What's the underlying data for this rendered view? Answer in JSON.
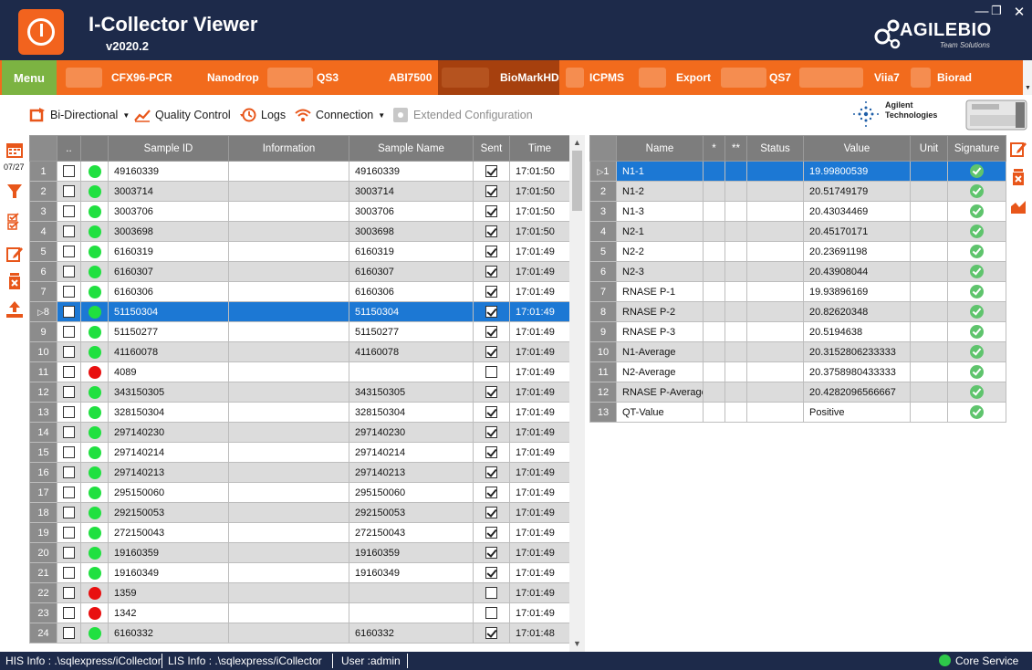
{
  "app": {
    "title": "I-Collector Viewer",
    "version": "v2020.2",
    "brand_name": "AGILEBIO",
    "brand_tagline": "Team Solutions"
  },
  "nav": {
    "menu_label": "Menu",
    "items": [
      "CFX96-PCR",
      "Nanodrop",
      "QS3",
      "ABI7500",
      "BioMarkHD",
      "ICPMS",
      "Export",
      "QS7",
      "Viia7",
      "Biorad"
    ],
    "active": "BioMarkHD"
  },
  "toolbar": {
    "bidirectional": "Bi-Directional",
    "quality_control": "Quality Control",
    "logs": "Logs",
    "connection": "Connection",
    "extended_configuration": "Extended Configuration"
  },
  "agilent": {
    "line1": "Agilent",
    "line2": "Technologies"
  },
  "side": {
    "date_label": "07/27"
  },
  "samples": {
    "columns": [
      "..",
      "Sample ID",
      "Information",
      "Sample Name",
      "Sent",
      "Time"
    ],
    "rows": [
      {
        "n": "1",
        "status": "green",
        "id": "49160339",
        "info": "",
        "name": "49160339",
        "sent": true,
        "time": "17:01:50"
      },
      {
        "n": "2",
        "status": "green",
        "id": "3003714",
        "info": "",
        "name": "3003714",
        "sent": true,
        "time": "17:01:50"
      },
      {
        "n": "3",
        "status": "green",
        "id": "3003706",
        "info": "",
        "name": "3003706",
        "sent": true,
        "time": "17:01:50"
      },
      {
        "n": "4",
        "status": "green",
        "id": "3003698",
        "info": "",
        "name": "3003698",
        "sent": true,
        "time": "17:01:50"
      },
      {
        "n": "5",
        "status": "green",
        "id": "6160319",
        "info": "",
        "name": "6160319",
        "sent": true,
        "time": "17:01:49"
      },
      {
        "n": "6",
        "status": "green",
        "id": "6160307",
        "info": "",
        "name": "6160307",
        "sent": true,
        "time": "17:01:49"
      },
      {
        "n": "7",
        "status": "green",
        "id": "6160306",
        "info": "",
        "name": "6160306",
        "sent": true,
        "time": "17:01:49"
      },
      {
        "n": "8",
        "status": "green",
        "id": "51150304",
        "info": "",
        "name": "51150304",
        "sent": true,
        "time": "17:01:49",
        "selected": true
      },
      {
        "n": "9",
        "status": "green",
        "id": "51150277",
        "info": "",
        "name": "51150277",
        "sent": true,
        "time": "17:01:49"
      },
      {
        "n": "10",
        "status": "green",
        "id": "41160078",
        "info": "",
        "name": "41160078",
        "sent": true,
        "time": "17:01:49"
      },
      {
        "n": "11",
        "status": "red",
        "id": "4089",
        "info": "",
        "name": "",
        "sent": false,
        "time": "17:01:49"
      },
      {
        "n": "12",
        "status": "green",
        "id": "343150305",
        "info": "",
        "name": "343150305",
        "sent": true,
        "time": "17:01:49"
      },
      {
        "n": "13",
        "status": "green",
        "id": "328150304",
        "info": "",
        "name": "328150304",
        "sent": true,
        "time": "17:01:49"
      },
      {
        "n": "14",
        "status": "green",
        "id": "297140230",
        "info": "",
        "name": "297140230",
        "sent": true,
        "time": "17:01:49"
      },
      {
        "n": "15",
        "status": "green",
        "id": "297140214",
        "info": "",
        "name": "297140214",
        "sent": true,
        "time": "17:01:49"
      },
      {
        "n": "16",
        "status": "green",
        "id": "297140213",
        "info": "",
        "name": "297140213",
        "sent": true,
        "time": "17:01:49"
      },
      {
        "n": "17",
        "status": "green",
        "id": "295150060",
        "info": "",
        "name": "295150060",
        "sent": true,
        "time": "17:01:49"
      },
      {
        "n": "18",
        "status": "green",
        "id": "292150053",
        "info": "",
        "name": "292150053",
        "sent": true,
        "time": "17:01:49"
      },
      {
        "n": "19",
        "status": "green",
        "id": "272150043",
        "info": "",
        "name": "272150043",
        "sent": true,
        "time": "17:01:49"
      },
      {
        "n": "20",
        "status": "green",
        "id": "19160359",
        "info": "",
        "name": "19160359",
        "sent": true,
        "time": "17:01:49"
      },
      {
        "n": "21",
        "status": "green",
        "id": "19160349",
        "info": "",
        "name": "19160349",
        "sent": true,
        "time": "17:01:49"
      },
      {
        "n": "22",
        "status": "red",
        "id": "1359",
        "info": "",
        "name": "",
        "sent": false,
        "time": "17:01:49"
      },
      {
        "n": "23",
        "status": "red",
        "id": "1342",
        "info": "",
        "name": "",
        "sent": false,
        "time": "17:01:49"
      },
      {
        "n": "24",
        "status": "green",
        "id": "6160332",
        "info": "",
        "name": "6160332",
        "sent": true,
        "time": "17:01:48"
      }
    ]
  },
  "results": {
    "columns": [
      "Name",
      "*",
      "**",
      "Status",
      "Value",
      "Unit",
      "Signature"
    ],
    "rows": [
      {
        "n": "1",
        "name": "N1-1",
        "status": "",
        "value": "19.99800539",
        "unit": "",
        "selected": true
      },
      {
        "n": "2",
        "name": "N1-2",
        "status": "",
        "value": "20.51749179",
        "unit": ""
      },
      {
        "n": "3",
        "name": "N1-3",
        "status": "",
        "value": "20.43034469",
        "unit": ""
      },
      {
        "n": "4",
        "name": "N2-1",
        "status": "",
        "value": "20.45170171",
        "unit": ""
      },
      {
        "n": "5",
        "name": "N2-2",
        "status": "",
        "value": "20.23691198",
        "unit": ""
      },
      {
        "n": "6",
        "name": "N2-3",
        "status": "",
        "value": "20.43908044",
        "unit": ""
      },
      {
        "n": "7",
        "name": "RNASE P-1",
        "status": "",
        "value": "19.93896169",
        "unit": ""
      },
      {
        "n": "8",
        "name": "RNASE P-2",
        "status": "",
        "value": "20.82620348",
        "unit": ""
      },
      {
        "n": "9",
        "name": "RNASE P-3",
        "status": "",
        "value": "20.5194638",
        "unit": ""
      },
      {
        "n": "10",
        "name": "N1-Average",
        "status": "",
        "value": "20.3152806233333",
        "unit": ""
      },
      {
        "n": "11",
        "name": "N2-Average",
        "status": "",
        "value": "20.3758980433333",
        "unit": ""
      },
      {
        "n": "12",
        "name": "RNASE P-Average",
        "status": "",
        "value": "20.4282096566667",
        "unit": ""
      },
      {
        "n": "13",
        "name": "QT-Value",
        "status": "",
        "value": "Positive",
        "unit": ""
      }
    ]
  },
  "status": {
    "his": "HIS Info : .\\sqlexpress/iCollector",
    "lis": "LIS Info : .\\sqlexpress/iCollector",
    "user": "User :admin",
    "service": "Core Service"
  },
  "colors": {
    "accent": "#f26b1d",
    "header_bg": "#1d2a4a",
    "menu_green": "#7cb342",
    "selection": "#1c78d4",
    "ok_green": "#20e040",
    "err_red": "#e81010"
  }
}
